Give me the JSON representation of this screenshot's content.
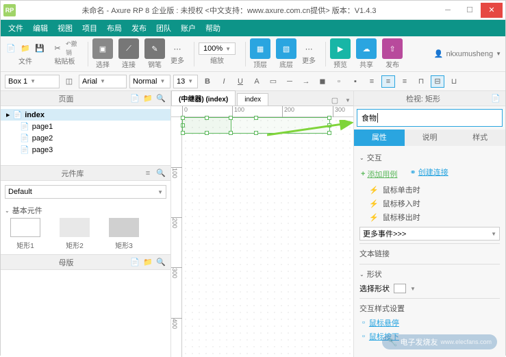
{
  "title": "未命名 - Axure RP 8 企业版 : 未授权   <中文支持：www.axure.com.cn提供> 版本：V1.4.3",
  "menus": [
    "文件",
    "编辑",
    "视图",
    "项目",
    "布局",
    "发布",
    "团队",
    "账户",
    "帮助"
  ],
  "tg": {
    "file": "文件",
    "clipboard": "粘贴板",
    "selmode": "选择",
    "conn": "连接",
    "pen": "钢笔",
    "more": "更多",
    "zoom": "缩放",
    "top": "顶层",
    "bottom": "底层",
    "preview": "预览",
    "share": "共享",
    "publish": "发布"
  },
  "zoom": "100%",
  "user": "nkxumusheng",
  "sel_name": "Box 1",
  "font": "Arial",
  "weight": "Normal",
  "size": "13",
  "panels": {
    "pages": "页面",
    "library": "元件库",
    "masters": "母版",
    "inspector": "检视: 矩形"
  },
  "tree": {
    "root": "index",
    "p1": "page1",
    "p2": "page2",
    "p3": "page3"
  },
  "lib": {
    "default": "Default",
    "basic": "基本元件",
    "r1": "矩形1",
    "r2": "矩形2",
    "r3": "矩形3"
  },
  "tabs": {
    "t1": "(中继器) (index)",
    "t2": "index"
  },
  "ruler_h": [
    "0",
    "100",
    "200",
    "300"
  ],
  "ruler_v": [
    "100",
    "200",
    "300",
    "400"
  ],
  "insp": {
    "input": "食物",
    "tab_attr": "属性",
    "tab_note": "说明",
    "tab_style": "样式",
    "sect_interact": "交互",
    "add_case": "添加用例",
    "create_link": "创建连接",
    "evt_click": "鼠标单击时",
    "evt_enter": "鼠标移入时",
    "evt_leave": "鼠标移出时",
    "more_events": "更多事件>>>",
    "text_link": "文本链接",
    "shape": "形状",
    "select_shape": "选择形状",
    "ix_style": "交互样式设置",
    "hover": "鼠标悬停",
    "press": "鼠标按下"
  },
  "watermark": "电子发烧友"
}
